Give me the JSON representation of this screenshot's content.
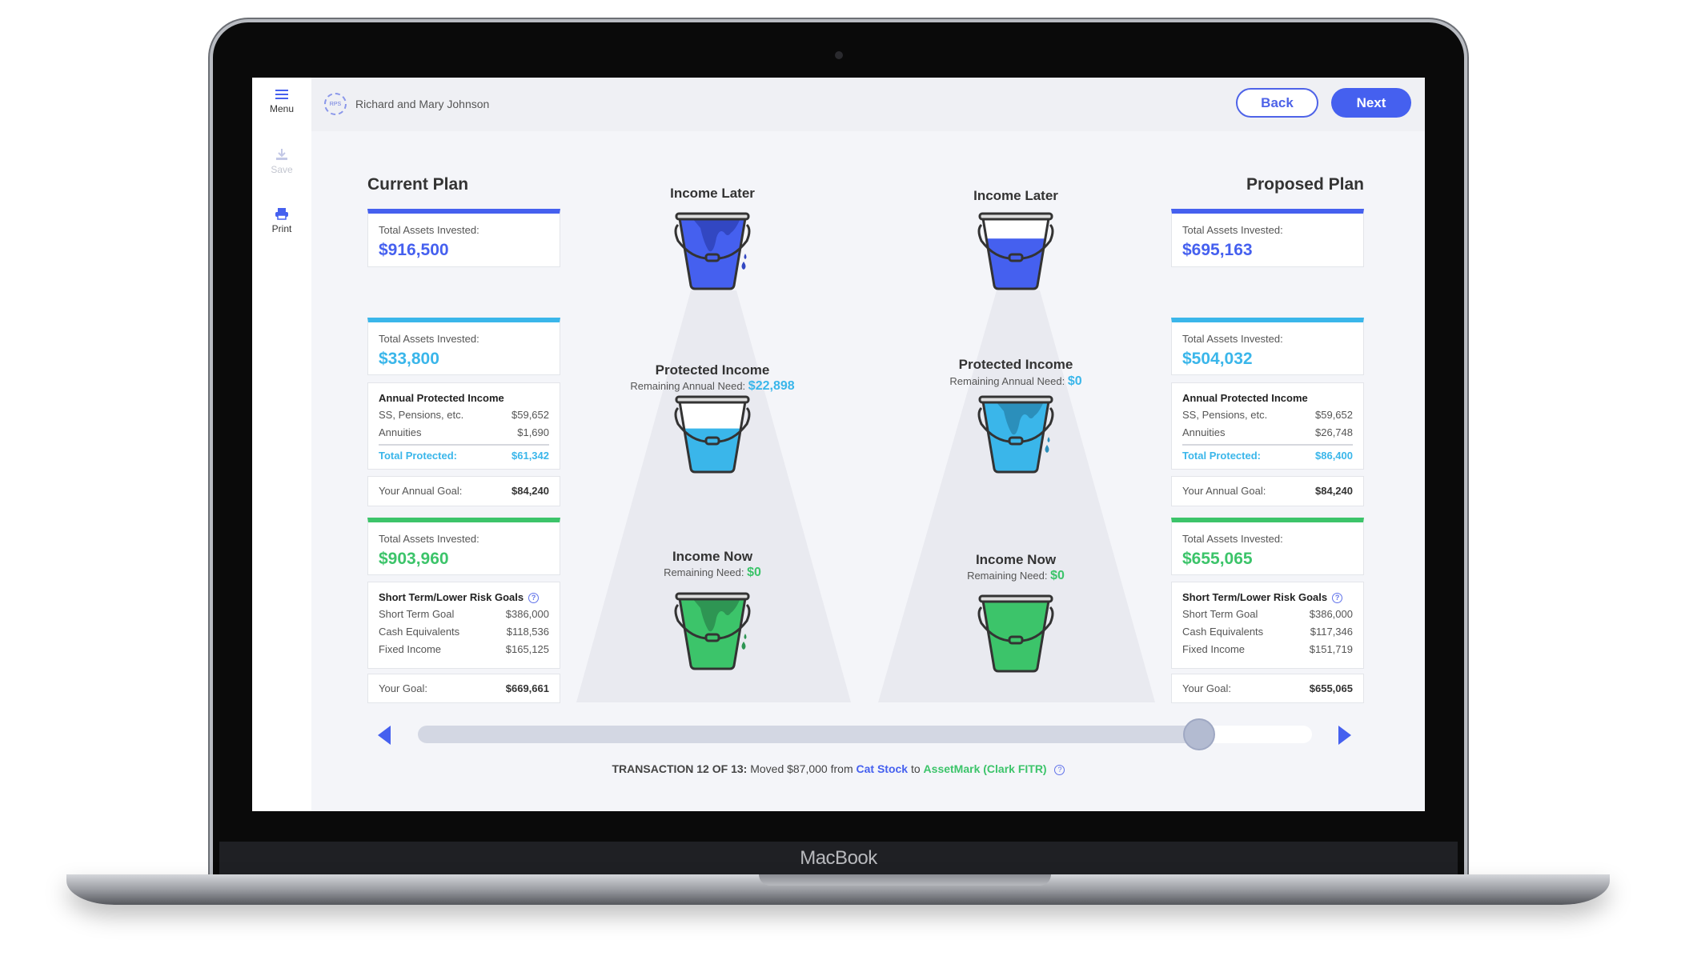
{
  "device_label": "MacBook",
  "colors": {
    "blue": "#4560ef",
    "light_blue": "#3ab6ea",
    "green": "#3cc46a",
    "track": "#d3d7e3"
  },
  "sidebar": {
    "items": [
      {
        "label": "Menu",
        "icon": "menu-icon",
        "disabled": false
      },
      {
        "label": "Save",
        "icon": "download-icon",
        "disabled": true
      },
      {
        "label": "Print",
        "icon": "printer-icon",
        "disabled": false
      }
    ]
  },
  "header": {
    "logo_text": "RPS",
    "client_name": "Richard and Mary Johnson",
    "back_label": "Back",
    "next_label": "Next"
  },
  "plans": [
    {
      "title": "Current Plan",
      "later": {
        "label": "Total Assets Invested:",
        "value": "$916,500"
      },
      "protected": {
        "label": "Total Assets Invested:",
        "value": "$33,800",
        "income_title": "Annual Protected Income",
        "rows": [
          {
            "label": "SS, Pensions, etc.",
            "value": "$59,652"
          },
          {
            "label": "Annuities",
            "value": "$1,690"
          }
        ],
        "total_label": "Total Protected:",
        "total_value": "$61,342",
        "goal_label": "Your Annual Goal:",
        "goal_value": "$84,240"
      },
      "now": {
        "label": "Total Assets Invested:",
        "value": "$903,960",
        "goals_title": "Short Term/Lower Risk Goals",
        "rows": [
          {
            "label": "Short Term Goal",
            "value": "$386,000"
          },
          {
            "label": "Cash Equivalents",
            "value": "$118,536"
          },
          {
            "label": "Fixed Income",
            "value": "$165,125"
          }
        ],
        "goal_label": "Your Goal:",
        "goal_value": "$669,661"
      },
      "buckets": {
        "later": {
          "title": "Income Later",
          "fill_level": 1.0,
          "overflowing": true
        },
        "protected": {
          "title": "Protected Income",
          "need_label": "Remaining Annual Need:",
          "need_value": "$22,898",
          "fill_level": 0.6,
          "overflowing": false
        },
        "now": {
          "title": "Income Now",
          "need_label": "Remaining Need:",
          "need_value": "$0",
          "fill_level": 1.0,
          "overflowing": true
        }
      }
    },
    {
      "title": "Proposed Plan",
      "later": {
        "label": "Total Assets Invested:",
        "value": "$695,163"
      },
      "protected": {
        "label": "Total Assets Invested:",
        "value": "$504,032",
        "income_title": "Annual Protected Income",
        "rows": [
          {
            "label": "SS, Pensions, etc.",
            "value": "$59,652"
          },
          {
            "label": "Annuities",
            "value": "$26,748"
          }
        ],
        "total_label": "Total Protected:",
        "total_value": "$86,400",
        "goal_label": "Your Annual Goal:",
        "goal_value": "$84,240"
      },
      "now": {
        "label": "Total Assets Invested:",
        "value": "$655,065",
        "goals_title": "Short Term/Lower Risk Goals",
        "rows": [
          {
            "label": "Short Term Goal",
            "value": "$386,000"
          },
          {
            "label": "Cash Equivalents",
            "value": "$117,346"
          },
          {
            "label": "Fixed Income",
            "value": "$151,719"
          }
        ],
        "goal_label": "Your Goal:",
        "goal_value": "$655,065"
      },
      "buckets": {
        "later": {
          "title": "Income Later",
          "fill_level": 0.7,
          "overflowing": false
        },
        "protected": {
          "title": "Protected Income",
          "need_label": "Remaining Annual Need:",
          "need_value": "$0",
          "fill_level": 1.0,
          "overflowing": true
        },
        "now": {
          "title": "Income Now",
          "need_label": "Remaining Need:",
          "need_value": "$0",
          "fill_level": 1.0,
          "overflowing": false
        }
      }
    }
  ],
  "slider": {
    "current": 12,
    "total": 13
  },
  "transaction": {
    "prefix": "TRANSACTION 12 OF 13:",
    "text": "Moved $87,000 from",
    "from": "Cat Stock",
    "to_word": "to",
    "to": "AssetMark (Clark FITR)"
  }
}
